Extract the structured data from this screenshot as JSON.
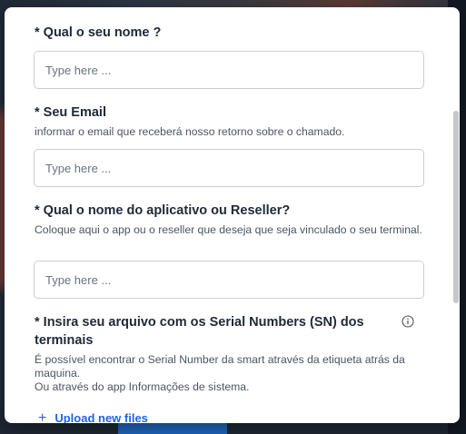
{
  "form": {
    "q1": {
      "label": "* Qual o seu nome ?",
      "placeholder": "Type here ..."
    },
    "q2": {
      "label": "* Seu Email",
      "help": "informar o email que receberá nosso retorno sobre o chamado.",
      "placeholder": "Type here ..."
    },
    "q3": {
      "label": "* Qual o nome do aplicativo ou Reseller?",
      "help": "Coloque aqui o app ou o reseller que deseja que seja vinculado o seu terminal.",
      "placeholder": "Type here ..."
    },
    "q4": {
      "label": "* Insira seu arquivo com os Serial Numbers (SN) dos terminais",
      "help_line1": "É possível encontrar o Serial Number da smart através da etiqueta atrás da maquina.",
      "help_line2": "Ou através do app Informações de sistema.",
      "upload_label": "Upload new files",
      "info_icon": "info-circle-icon"
    }
  },
  "colors": {
    "accent": "#2563eb",
    "label": "#1f2937",
    "border": "#c9ced6"
  }
}
